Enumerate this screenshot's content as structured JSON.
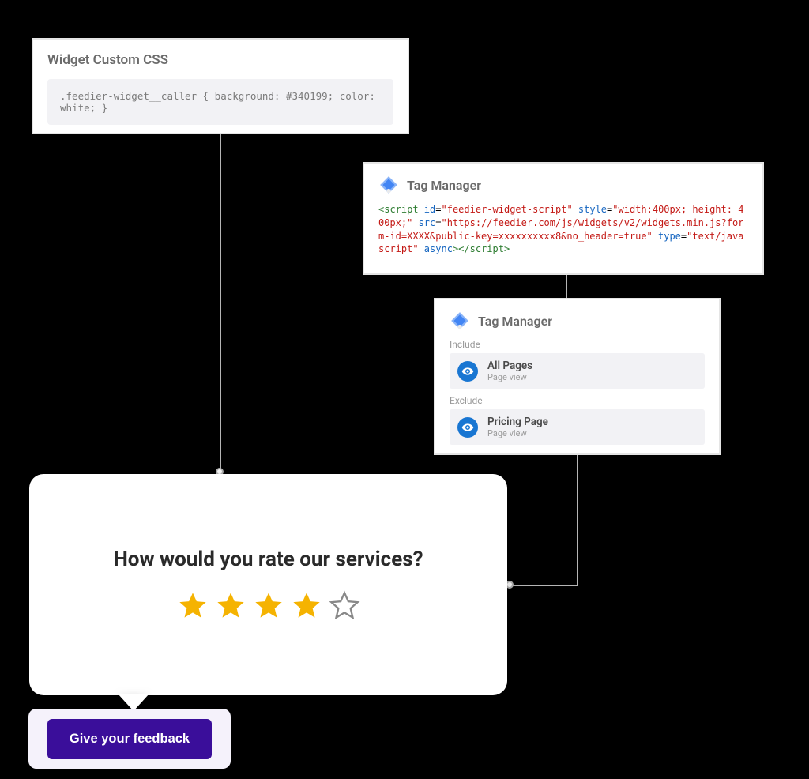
{
  "css_panel": {
    "title": "Widget Custom CSS",
    "code": ".feedier-widget__caller { background: #340199; color: white; }"
  },
  "tm_script": {
    "title": "Tag Manager",
    "tokens": [
      {
        "cls": "tok-green",
        "t": "<script"
      },
      {
        "cls": "tok-blue",
        "t": " id"
      },
      {
        "cls": "",
        "t": "="
      },
      {
        "cls": "tok-red",
        "t": "\"feedier-widget-script\""
      },
      {
        "cls": "tok-blue",
        "t": " style"
      },
      {
        "cls": "",
        "t": "="
      },
      {
        "cls": "tok-red",
        "t": "\"width:400px; height: 400px;\""
      },
      {
        "cls": "tok-blue",
        "t": " src"
      },
      {
        "cls": "",
        "t": "="
      },
      {
        "cls": "tok-red",
        "t": "\"https://feedier.com/js/widgets/v2/widgets.min.js?form-id=XXXX&public-key=xxxxxxxxxx8&no_header=true\""
      },
      {
        "cls": "tok-blue",
        "t": " type"
      },
      {
        "cls": "",
        "t": "="
      },
      {
        "cls": "tok-red",
        "t": "\"text/javascript\""
      },
      {
        "cls": "tok-blue",
        "t": " async"
      },
      {
        "cls": "tok-green",
        "t": "></script>"
      }
    ]
  },
  "tm_triggers": {
    "title": "Tag Manager",
    "include_label": "Include",
    "exclude_label": "Exclude",
    "include": {
      "title": "All Pages",
      "sub": "Page view"
    },
    "exclude": {
      "title": "Pricing Page",
      "sub": "Page view"
    }
  },
  "survey": {
    "question": "How would you rate our services?",
    "rating_filled": 4,
    "rating_total": 5
  },
  "feedback_button": {
    "label": "Give your feedback"
  }
}
